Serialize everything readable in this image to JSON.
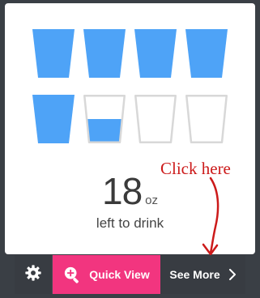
{
  "widget": {
    "glasses": [
      {
        "fill": 1
      },
      {
        "fill": 1
      },
      {
        "fill": 1
      },
      {
        "fill": 1
      },
      {
        "fill": 1
      },
      {
        "fill": 0.5
      },
      {
        "fill": 0
      },
      {
        "fill": 0
      }
    ],
    "amount_value": "18",
    "amount_unit": "oz",
    "caption": "left to drink"
  },
  "colors": {
    "water": "#4ea3f7",
    "accent": "#f2357f",
    "bar_background": "#383c42",
    "annotation": "#cc1a1a"
  },
  "annotation": {
    "text": "Click here"
  },
  "toolbar": {
    "settings_icon": "gear-icon",
    "quick_view_icon": "magnify-plus-icon",
    "quick_view_label": "Quick View",
    "see_more_label": "See More",
    "see_more_icon": "chevron-right-icon"
  }
}
